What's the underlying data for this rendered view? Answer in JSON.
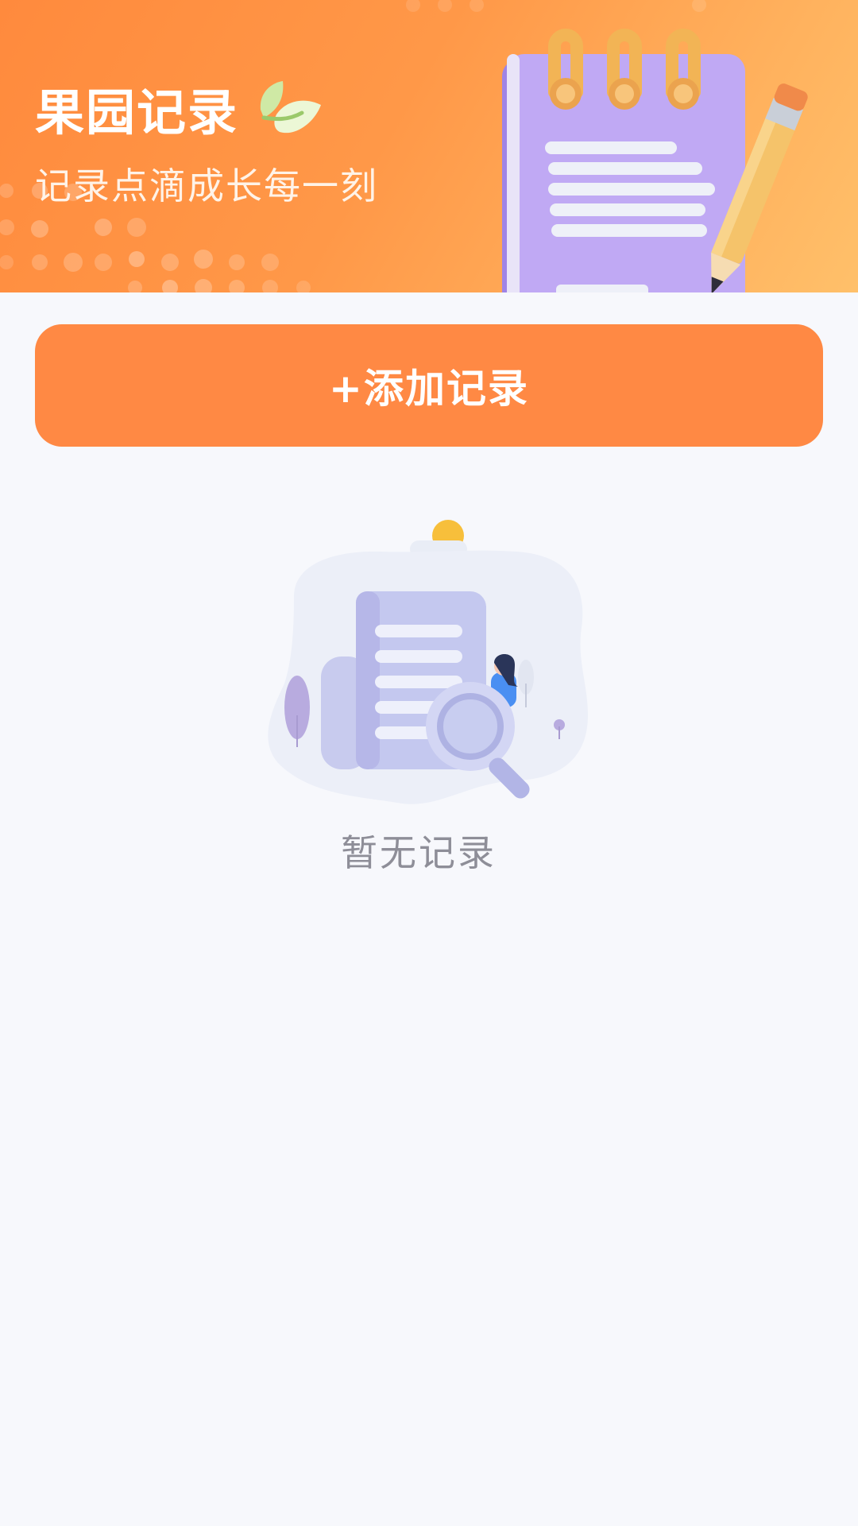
{
  "banner": {
    "title": "果园记录",
    "subtitle": "记录点滴成长每一刻",
    "leaf_icon": "leaf-icon",
    "illustration": "notebook-pencil-illustration",
    "gradient_start": "#ff8a3d",
    "gradient_end": "#ffc06a"
  },
  "actions": {
    "add_record_label": "+添加记录",
    "button_color": "#ff8944"
  },
  "empty_state": {
    "illustration": "document-search-illustration",
    "message": "暂无记录",
    "text_color": "#8e8e98"
  },
  "page": {
    "background": "#f7f8fc"
  }
}
